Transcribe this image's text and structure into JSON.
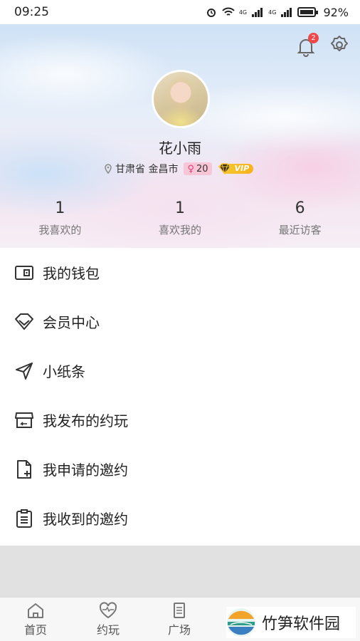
{
  "status_bar": {
    "time": "09:25",
    "signal_labels": [
      "4G",
      "4G"
    ],
    "battery": "92%"
  },
  "header": {
    "notification_count": "2",
    "username": "花小雨",
    "location": "甘肃省 金昌市",
    "gender_symbol": "♀",
    "age": "20",
    "vip_label": "VIP",
    "stats": [
      {
        "value": "1",
        "label": "我喜欢的"
      },
      {
        "value": "1",
        "label": "喜欢我的"
      },
      {
        "value": "6",
        "label": "最近访客"
      }
    ]
  },
  "menu": [
    {
      "label": "我的钱包",
      "icon": "wallet-icon"
    },
    {
      "label": "会员中心",
      "icon": "diamond-icon"
    },
    {
      "label": "小纸条",
      "icon": "send-icon"
    },
    {
      "label": "我发布的约玩",
      "icon": "store-icon"
    },
    {
      "label": "我申请的邀约",
      "icon": "file-add-icon"
    },
    {
      "label": "我收到的邀约",
      "icon": "clipboard-icon"
    }
  ],
  "tabs": [
    {
      "label": "首页",
      "icon": "home-icon"
    },
    {
      "label": "约玩",
      "icon": "heart-pulse-icon"
    },
    {
      "label": "广场",
      "icon": "document-icon"
    }
  ],
  "watermark": {
    "text": "竹笋软件园"
  },
  "colors": {
    "badge_red": "#f04848",
    "vip_gold": "#f6c531",
    "gender_pink": "#f9c6d8"
  }
}
